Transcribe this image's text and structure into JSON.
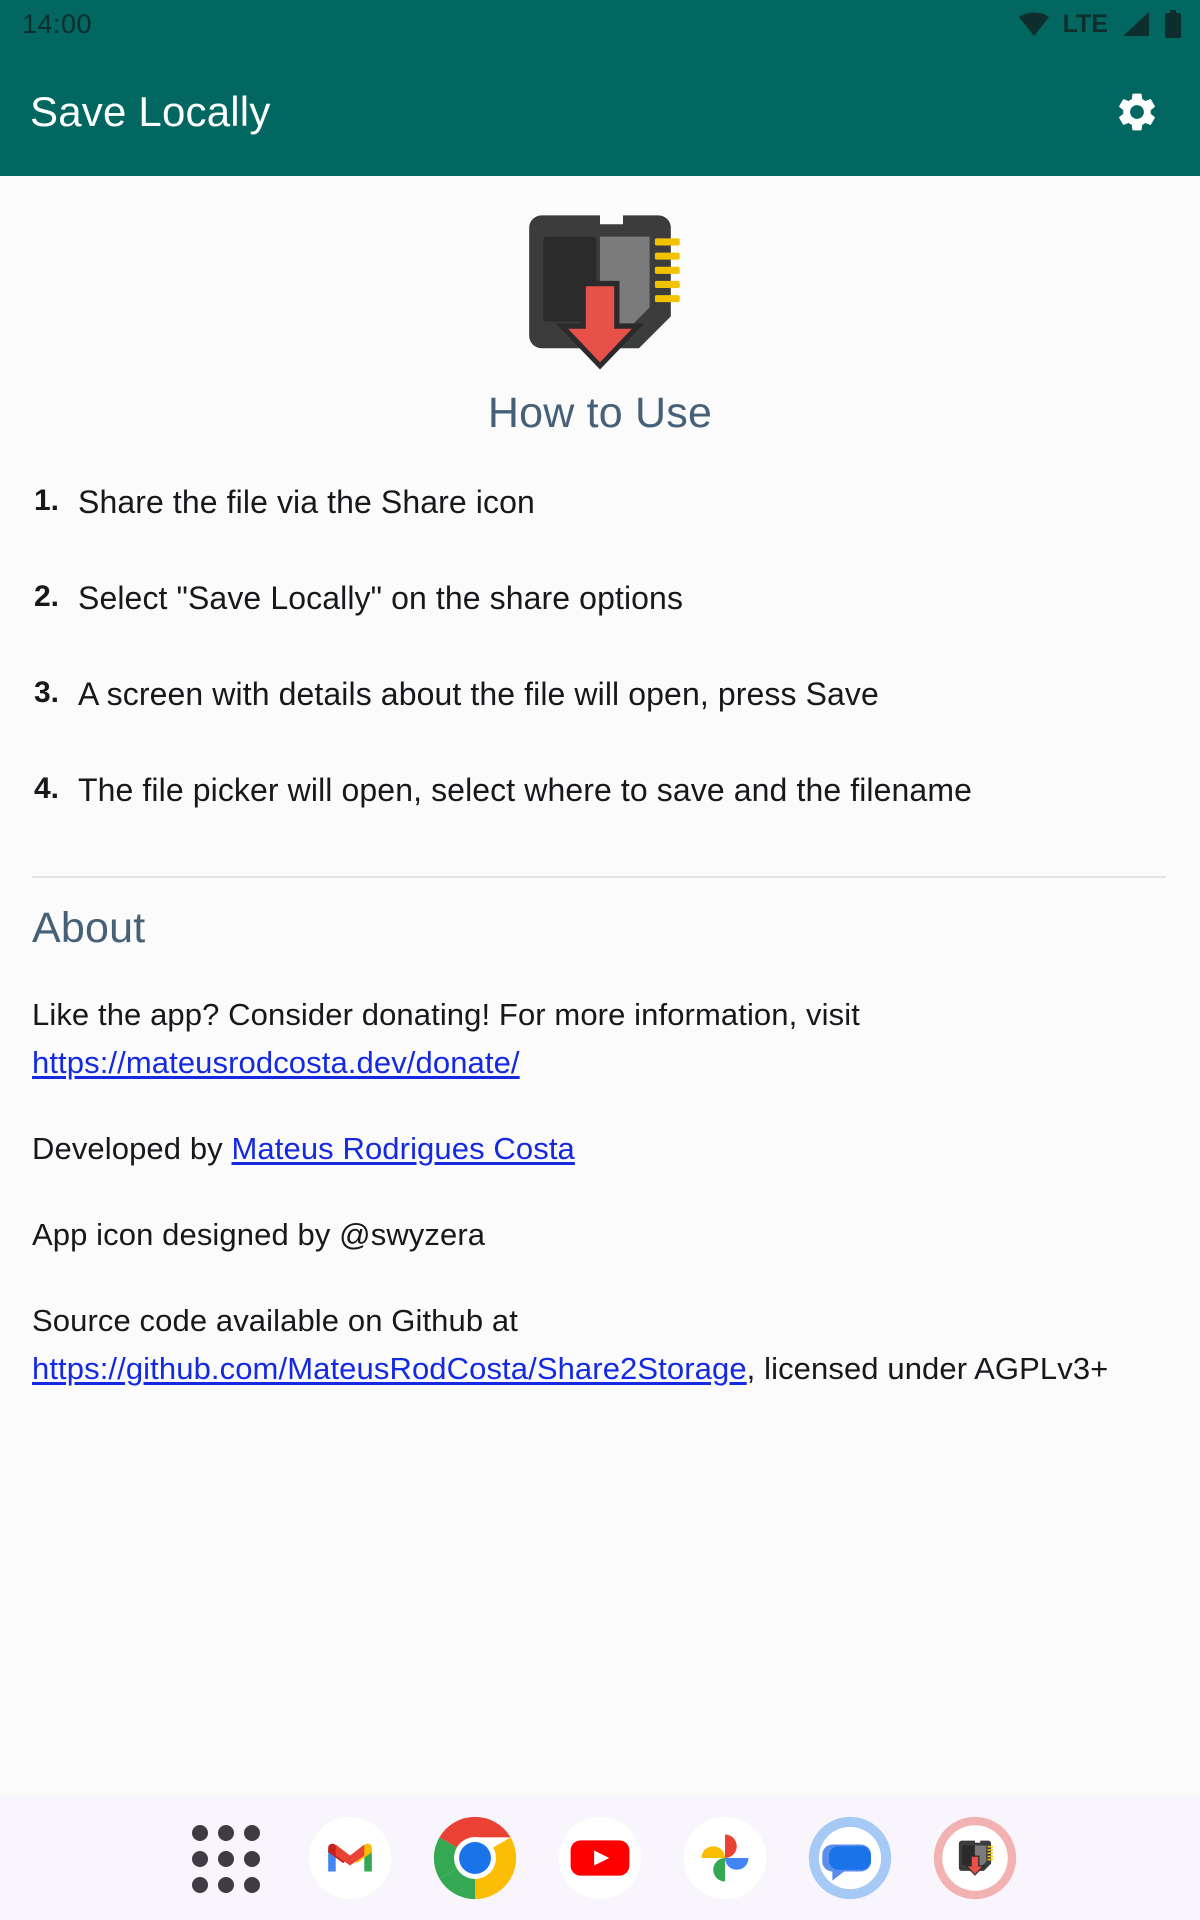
{
  "statusbar": {
    "time": "14:00",
    "network_label": "LTE",
    "icons": [
      "wifi-icon",
      "lte-label",
      "cellular-signal-icon",
      "battery-icon"
    ]
  },
  "appbar": {
    "title": "Save Locally",
    "settings_icon": "gear-icon",
    "background_color": "#016760",
    "title_color": "#ffffff"
  },
  "hero": {
    "app_icon": "sd-card-download-icon",
    "title": "How to Use",
    "title_color": "#466078"
  },
  "steps": [
    {
      "num": "1.",
      "text": "Share the file via the Share icon"
    },
    {
      "num": "2.",
      "text": "Select \"Save Locally\" on the share options"
    },
    {
      "num": "3.",
      "text": "A screen with details about the file will open, press Save"
    },
    {
      "num": "4.",
      "text": "The file picker will open, select where to save and the filename"
    }
  ],
  "about": {
    "heading": "About",
    "heading_color": "#466078",
    "link_color": "#1429e0",
    "donate_lead": "Like the app? Consider donating! For more information, visit ",
    "donate_link": "https://mateusrodcosta.dev/donate/",
    "developed_lead": "Developed by ",
    "developer_link": "Mateus Rodrigues Costa",
    "icon_credit": "App icon designed by @swyzera",
    "source_lead": "Source code available on Github at ",
    "source_link": "https://github.com/MateusRodCosta/Share2Storage",
    "source_tail": ", licensed under AGPLv3+"
  },
  "dock": {
    "background_color": "#f8f5fc",
    "items": [
      {
        "name": "app-drawer-icon",
        "label": "All apps"
      },
      {
        "name": "gmail-icon",
        "label": "Gmail"
      },
      {
        "name": "chrome-icon",
        "label": "Chrome"
      },
      {
        "name": "youtube-icon",
        "label": "YouTube"
      },
      {
        "name": "google-photos-icon",
        "label": "Photos"
      },
      {
        "name": "google-messages-icon",
        "label": "Messages"
      },
      {
        "name": "save-locally-icon",
        "label": "Save Locally"
      }
    ]
  }
}
